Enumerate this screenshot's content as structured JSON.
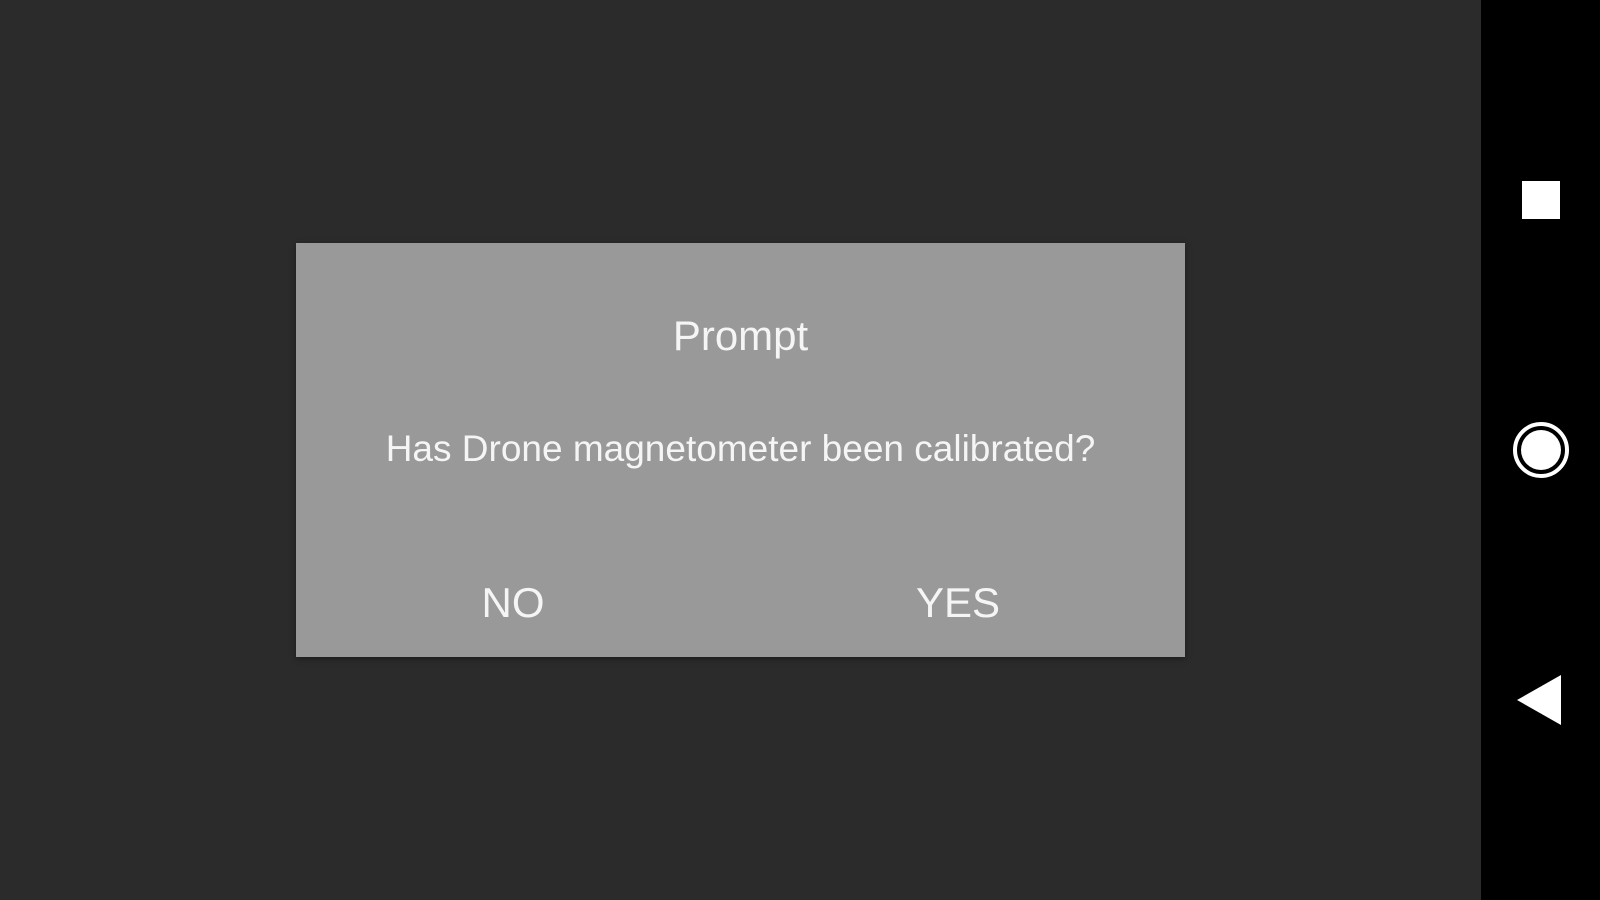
{
  "dialog": {
    "title": "Prompt",
    "message": "Has Drone magnetometer been calibrated?",
    "no_label": "NO",
    "yes_label": "YES",
    "background_color": "#999999",
    "text_color": "#f5f5f5"
  },
  "nav_bar": {
    "background_color": "#000000",
    "buttons": [
      {
        "icon": "square-recents-icon"
      },
      {
        "icon": "circle-home-icon"
      },
      {
        "icon": "triangle-back-icon"
      }
    ]
  },
  "colors": {
    "app_background": "#2b2b2b"
  }
}
